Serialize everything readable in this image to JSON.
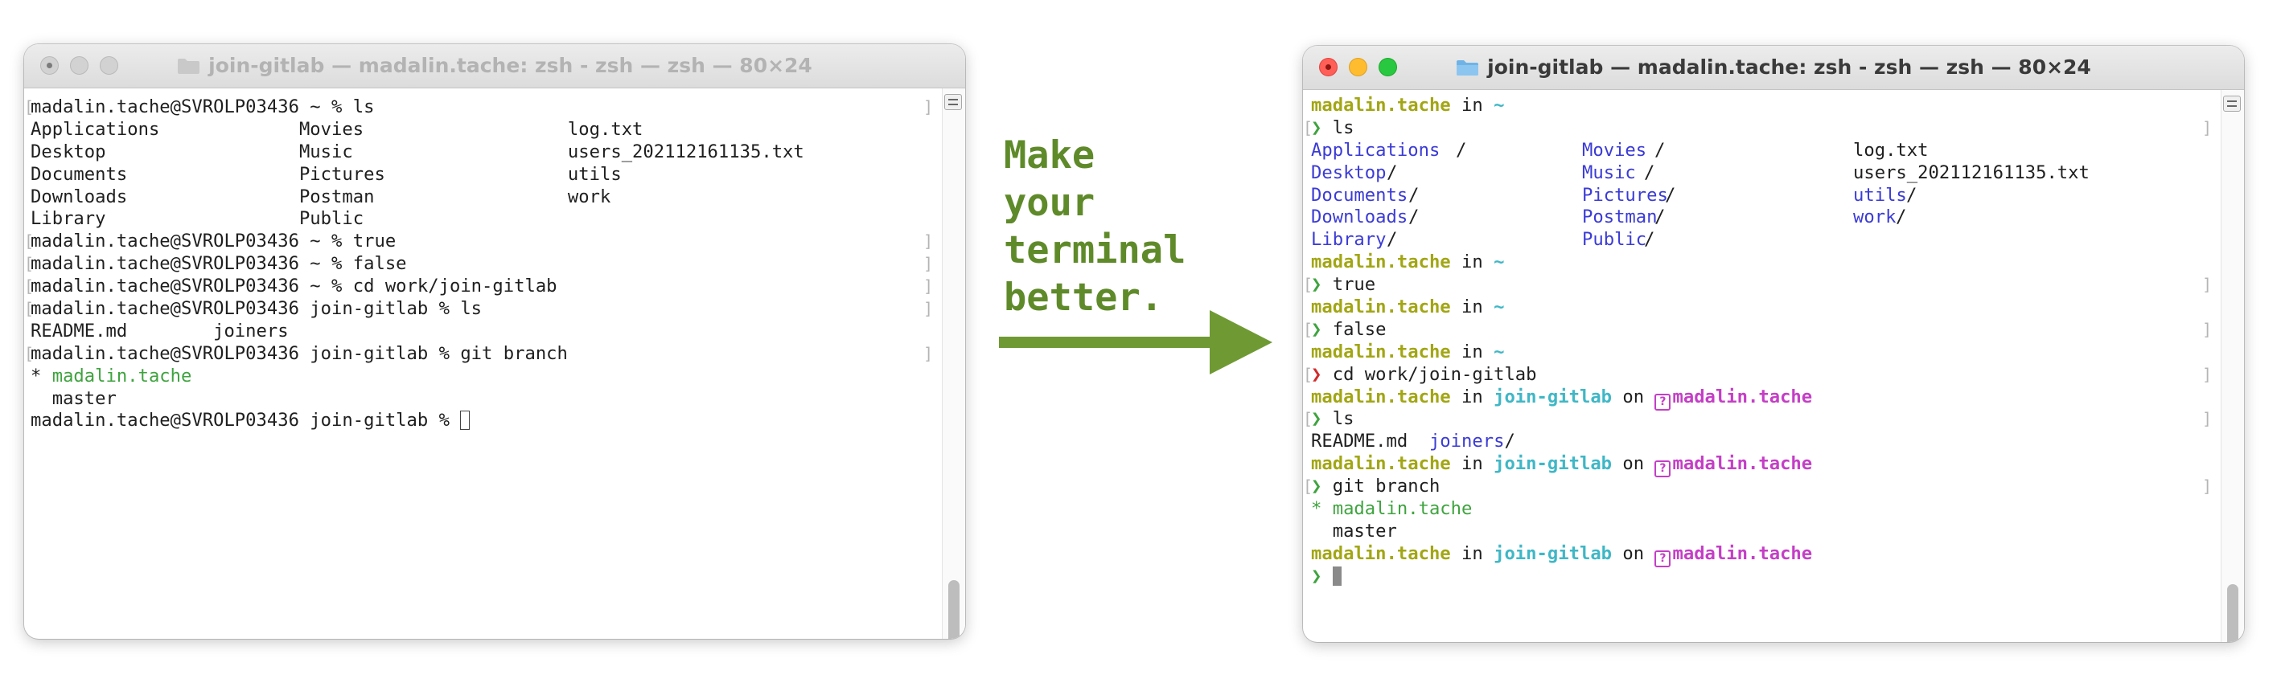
{
  "colors": {
    "prompt_user": "#a2a614",
    "path_cyan": "#3fb7c6",
    "branch_magenta": "#c43fc6",
    "dir_blue": "#3b3bd6",
    "git_green": "#3fa33f",
    "error_red": "#d12a2a",
    "tagline_green": "#5f8a2a"
  },
  "icons": {
    "folder": "folder-icon",
    "git_branch": "git-branch-icon",
    "arrow": "right-arrow-icon"
  },
  "left_window": {
    "title": "join-gitlab — madalin.tache: zsh - zsh — zsh — 80×24",
    "lines": [
      "madalin.tache@SVROLP03436 ~ % ls",
      "Applications             Movies                   log.txt",
      "Desktop                  Music                    users_202112161135.txt",
      "Documents                Pictures                 utils",
      "Downloads                Postman                  work",
      "Library                  Public",
      "madalin.tache@SVROLP03436 ~ % true",
      "madalin.tache@SVROLP03436 ~ % false",
      "madalin.tache@SVROLP03436 ~ % cd work/join-gitlab",
      "madalin.tache@SVROLP03436 join-gitlab % ls",
      "README.md        joiners",
      "madalin.tache@SVROLP03436 join-gitlab % git branch",
      "* ",
      "  master",
      "madalin.tache@SVROLP03436 join-gitlab % "
    ],
    "current_branch": "madalin.tache"
  },
  "tagline": "Make\nyour\nterminal\nbetter.",
  "right_window": {
    "title": "join-gitlab — madalin.tache: zsh - zsh — zsh — 80×24",
    "user": "madalin.tache",
    "in": "in",
    "on": "on",
    "home": "~",
    "dir": "join-gitlab",
    "branch": "madalin.tache",
    "prompt_char": "❯",
    "cmd_ls": "ls",
    "cmd_true": "true",
    "cmd_false": "false",
    "cmd_cd": "cd work/join-gitlab",
    "cmd_branch": "git branch",
    "ls_home": {
      "col1": [
        "Applications",
        "Desktop",
        "Documents",
        "Downloads",
        "Library"
      ],
      "col2": [
        "Movies",
        "Music",
        "Pictures",
        "Postman",
        "Public"
      ],
      "col3": [
        "log.txt",
        "users_202112161135.txt",
        "utils",
        "work"
      ]
    },
    "ls_repo_file": "README.md",
    "ls_repo_dir": "joiners",
    "branch_star": "* madalin.tache",
    "branch_other": "  master"
  }
}
